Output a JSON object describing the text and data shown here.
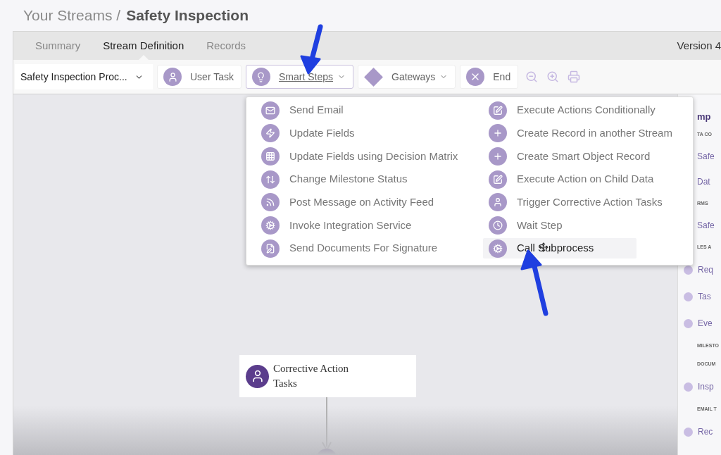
{
  "breadcrumb": {
    "parent": "Your Streams /",
    "current": "Safety Inspection"
  },
  "tabs": [
    {
      "label": "Summary",
      "selected": false
    },
    {
      "label": "Stream Definition",
      "selected": true
    },
    {
      "label": "Records",
      "selected": false
    }
  ],
  "version": "Version 4",
  "toolbar": {
    "process_select": "Safety Inspection Proc...",
    "buttons": [
      {
        "kind": "user",
        "label": "User Task",
        "open": false,
        "has_caret": false
      },
      {
        "kind": "bulb",
        "label": "Smart Steps",
        "open": true,
        "has_caret": true
      },
      {
        "kind": "diamond",
        "label": "Gateways",
        "open": false,
        "has_caret": true
      },
      {
        "kind": "end",
        "label": "End",
        "open": false,
        "has_caret": false
      }
    ]
  },
  "menu": {
    "columns": [
      [
        {
          "kind": "email",
          "label": "Send Email",
          "hovered": false
        },
        {
          "kind": "bolt",
          "label": "Update Fields",
          "hovered": false
        },
        {
          "kind": "matrix",
          "label": "Update Fields using Decision Matrix",
          "hovered": false
        },
        {
          "kind": "updown",
          "label": "Change Milestone Status",
          "hovered": false
        },
        {
          "kind": "rss",
          "label": "Post Message on Activity Feed",
          "hovered": false
        },
        {
          "kind": "gears",
          "label": "Invoke Integration Service",
          "hovered": false
        },
        {
          "kind": "doc",
          "label": "Send Documents For Signature",
          "hovered": false
        }
      ],
      [
        {
          "kind": "edit",
          "label": "Execute Actions Conditionally",
          "hovered": false
        },
        {
          "kind": "plus",
          "label": "Create Record in another Stream",
          "hovered": false
        },
        {
          "kind": "plus",
          "label": "Create Smart Object Record",
          "hovered": false
        },
        {
          "kind": "edit",
          "label": "Execute Action on Child Data",
          "hovered": false
        },
        {
          "kind": "person",
          "label": "Trigger Corrective Action Tasks",
          "hovered": false
        },
        {
          "kind": "clock",
          "label": "Wait Step",
          "hovered": false
        },
        {
          "kind": "gears",
          "label": "Call Subprocess",
          "hovered": true
        }
      ]
    ]
  },
  "sidebar": [
    {
      "kind": "title",
      "label": "mp"
    },
    {
      "kind": "section",
      "label": "TA CO"
    },
    {
      "kind": "link",
      "label": "Safe"
    },
    {
      "kind": "link",
      "label": "Dat"
    },
    {
      "kind": "section",
      "label": "RMS"
    },
    {
      "kind": "link",
      "label": "Safe"
    },
    {
      "kind": "section",
      "label": "LES A"
    },
    {
      "kind": "dot_link",
      "label": "Req"
    },
    {
      "kind": "dot_link",
      "label": "Tas"
    },
    {
      "kind": "dot_link",
      "label": "Eve"
    },
    {
      "kind": "section",
      "label": "MILESTO"
    },
    {
      "kind": "section",
      "label": "DOCUM"
    },
    {
      "kind": "dot_link",
      "label": "Insp"
    },
    {
      "kind": "section",
      "label": "EMAIL T"
    },
    {
      "kind": "dot_link",
      "label": "Rec"
    }
  ],
  "canvas": {
    "node": {
      "label": "Corrective Action Tasks"
    }
  }
}
